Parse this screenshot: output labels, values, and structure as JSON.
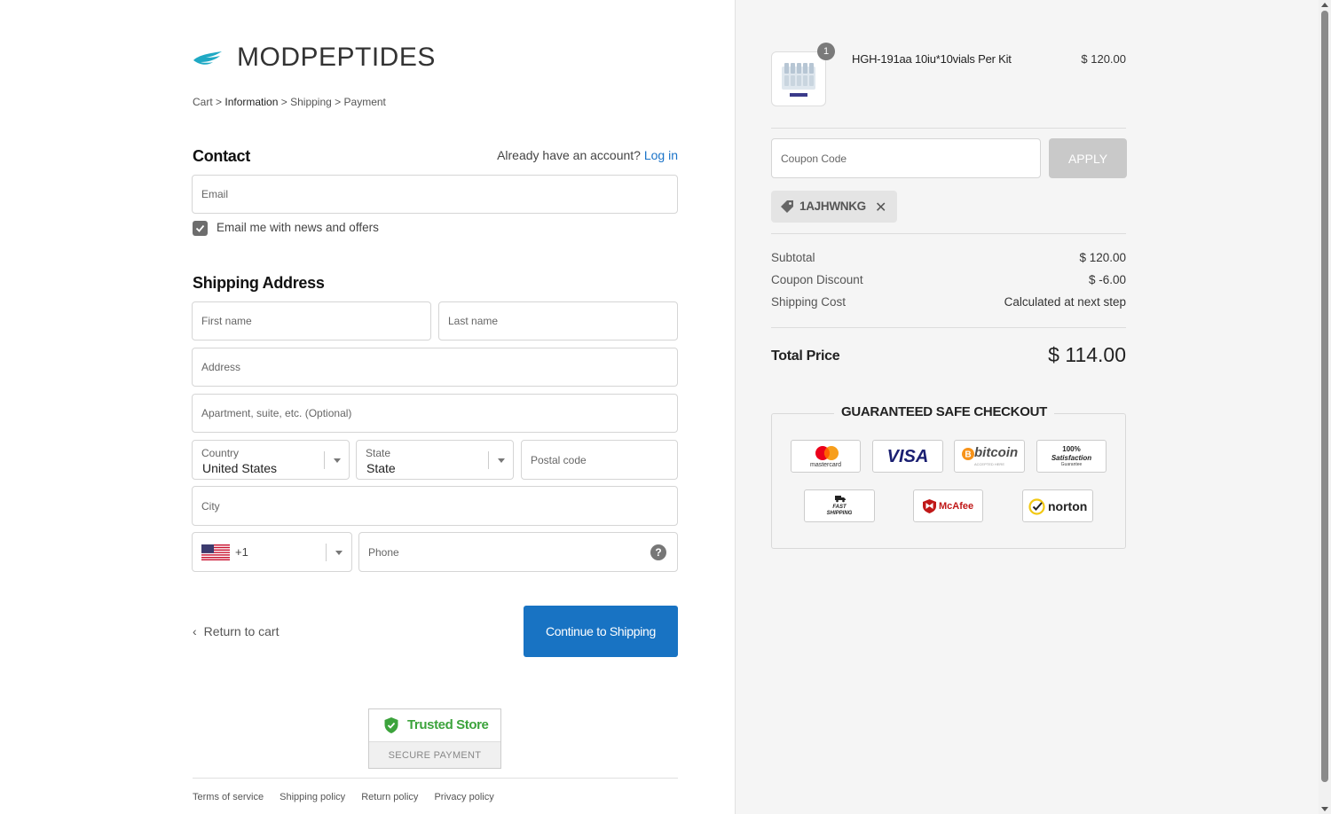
{
  "brand": {
    "name": "MODPEPTIDES",
    "accent": "#1fa9c4"
  },
  "breadcrumb": {
    "cart": "Cart",
    "information": "Information",
    "shipping": "Shipping",
    "payment": "Payment",
    "sep": ">"
  },
  "contact": {
    "title": "Contact",
    "account_prompt": "Already have an account?",
    "login_link": "Log in",
    "email_placeholder": "Email",
    "newsletter_label": "Email me with news and offers",
    "newsletter_checked": true
  },
  "shipping": {
    "title": "Shipping Address",
    "first_name_placeholder": "First name",
    "last_name_placeholder": "Last name",
    "address_placeholder": "Address",
    "apartment_placeholder": "Apartment, suite, etc. (Optional)",
    "country_label": "Country",
    "country_value": "United States",
    "state_label": "State",
    "state_value": "State",
    "postal_placeholder": "Postal code",
    "city_placeholder": "City",
    "phone_code": "+1",
    "phone_placeholder": "Phone",
    "help_glyph": "?"
  },
  "actions": {
    "return_label": "Return to cart",
    "continue_label": "Continue to Shipping",
    "continue_color": "#1873c3"
  },
  "trust": {
    "title": "Trusted Store",
    "subtitle": "SECURE PAYMENT",
    "color": "#3ca33c"
  },
  "footer": {
    "links": [
      "Terms of service",
      "Shipping policy",
      "Return policy",
      "Privacy policy"
    ]
  },
  "order": {
    "item_name": "HGH-191aa 10iu*10vials Per Kit",
    "item_price": "$ 120.00",
    "quantity": "1",
    "coupon_placeholder": "Coupon Code",
    "apply_label": "APPLY",
    "applied_code": "1AJHWNKG",
    "subtotal_label": "Subtotal",
    "subtotal_value": "$ 120.00",
    "discount_label": "Coupon Discount",
    "discount_value": "$ -6.00",
    "shipping_label": "Shipping Cost",
    "shipping_value": "Calculated at next step",
    "total_label": "Total Price",
    "total_value": "$ 114.00"
  },
  "safe_checkout": {
    "title": "GUARANTEED SAFE CHECKOUT",
    "badges": {
      "mastercard": "mastercard",
      "visa": "VISA",
      "bitcoin": "bitcoin",
      "bitcoin_sub": "ACCEPTED HERE",
      "satisfaction_top": "100%",
      "satisfaction_mid": "Satisfaction",
      "satisfaction_bot": "Guarantee",
      "fast_shipping_top": "FAST",
      "fast_shipping_bot": "SHIPPING",
      "mcafee": "McAfee",
      "norton": "norton"
    }
  }
}
